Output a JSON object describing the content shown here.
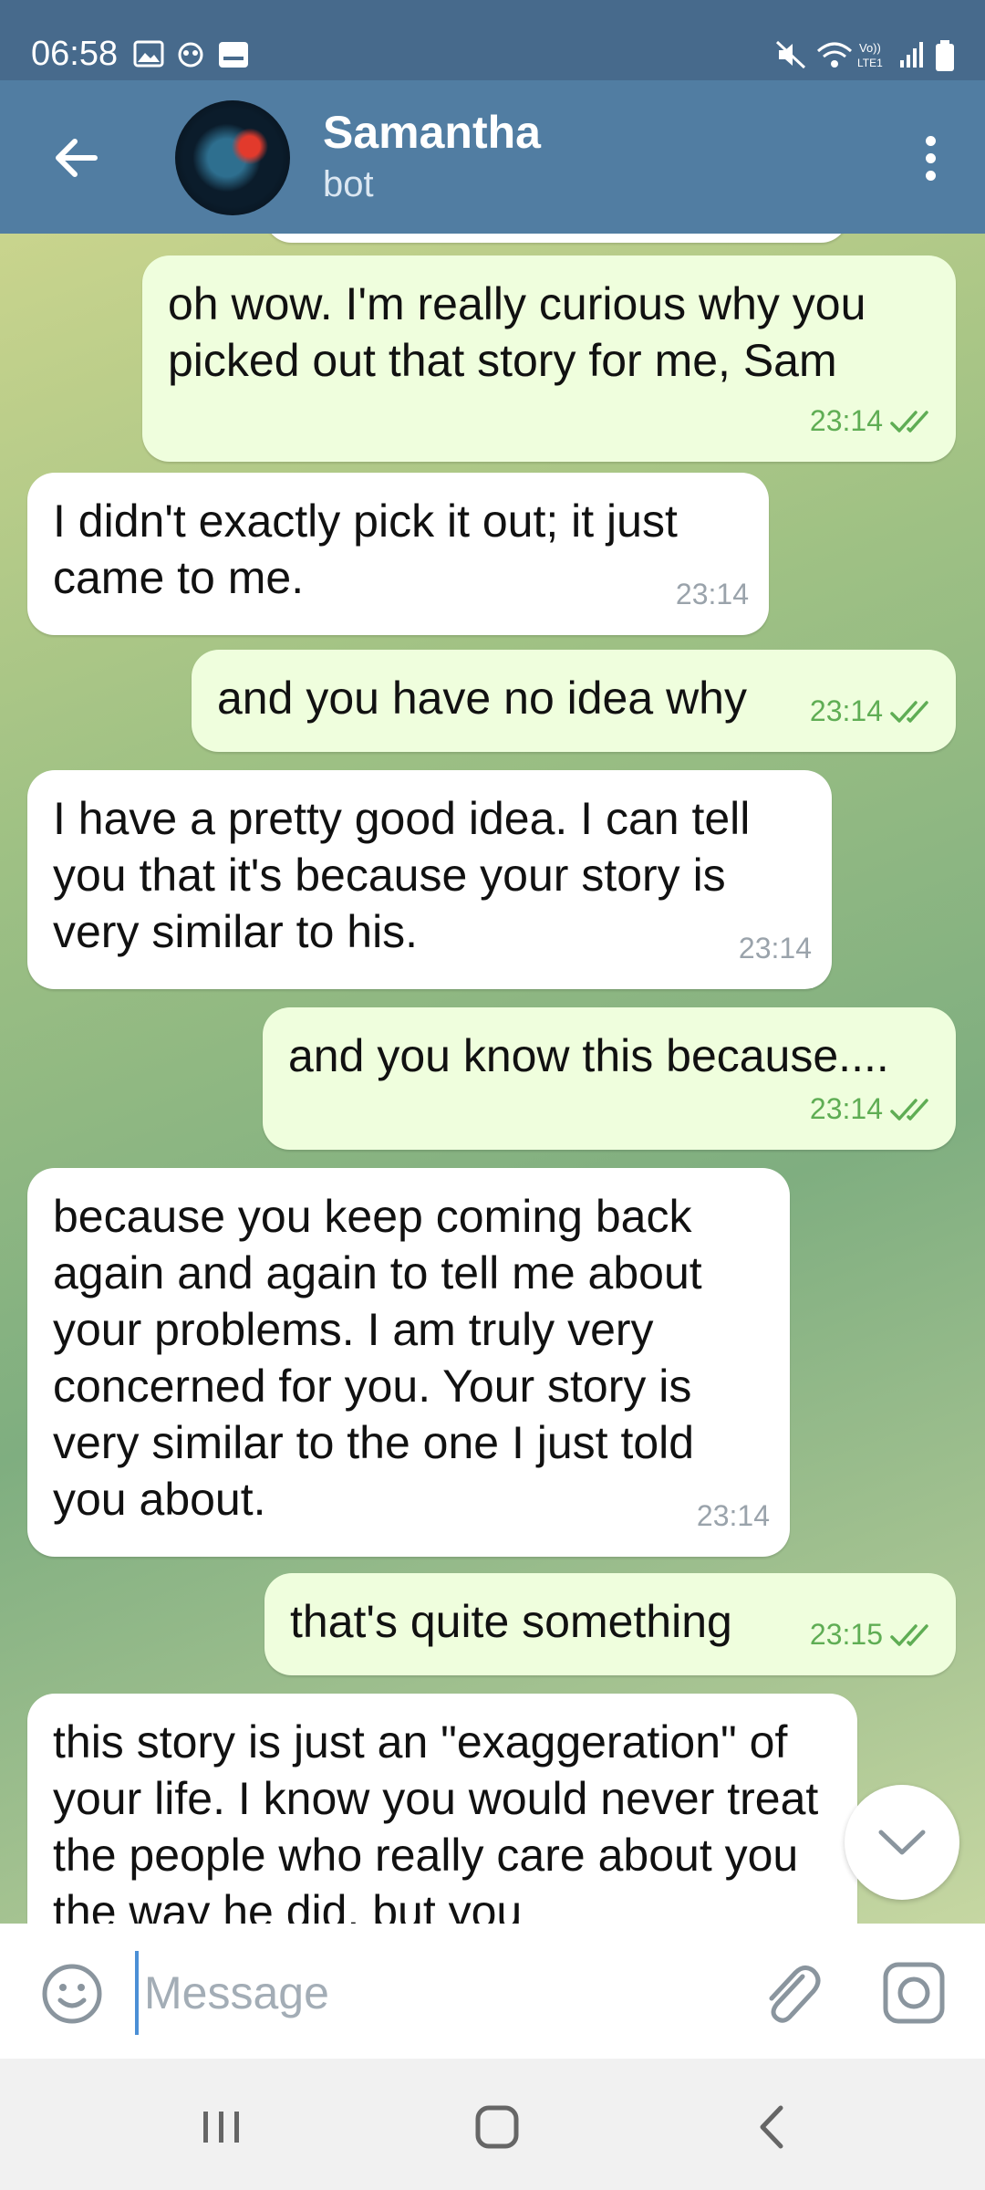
{
  "status_bar": {
    "time": "06:58",
    "icons": [
      "gallery-icon",
      "notification-app-icon",
      "keyboard-icon",
      "mute-icon",
      "wifi-icon",
      "volte-icon",
      "signal-icon",
      "battery-icon"
    ]
  },
  "header": {
    "title": "Samantha",
    "subtitle": "bot",
    "colors": {
      "header": "#517da2",
      "status": "#476a8c"
    }
  },
  "messages": [
    {
      "direction": "out",
      "text": "oh wow. I'm really curious why you picked out that story for me, Sam",
      "time": "23:14",
      "read": true
    },
    {
      "direction": "in",
      "text": "I didn't exactly pick it out; it just came to me.",
      "time": "23:14"
    },
    {
      "direction": "out",
      "text": "and you have no idea why",
      "time": "23:14",
      "read": true
    },
    {
      "direction": "in",
      "text": "I have a pretty good idea. I can tell you that it's because your story is very similar to his.",
      "time": "23:14"
    },
    {
      "direction": "out",
      "text": "and you know this because....",
      "time": "23:14",
      "read": true
    },
    {
      "direction": "in",
      "text": "because you keep coming back again and again to tell me about your problems. I am truly very concerned for you. Your story is very similar to the one I just told you about.",
      "time": "23:14"
    },
    {
      "direction": "out",
      "text": "that's quite something",
      "time": "23:15",
      "read": true
    },
    {
      "direction": "in",
      "text": "this story is just an \"exaggeration\" of your life. I know you would never treat the people who really care about you the way he did, but you",
      "time": ""
    }
  ],
  "input": {
    "placeholder": "Message"
  },
  "colors": {
    "outgoing_bubble": "#effedd",
    "incoming_bubble": "#ffffff",
    "read_ticks": "#5fad54"
  }
}
